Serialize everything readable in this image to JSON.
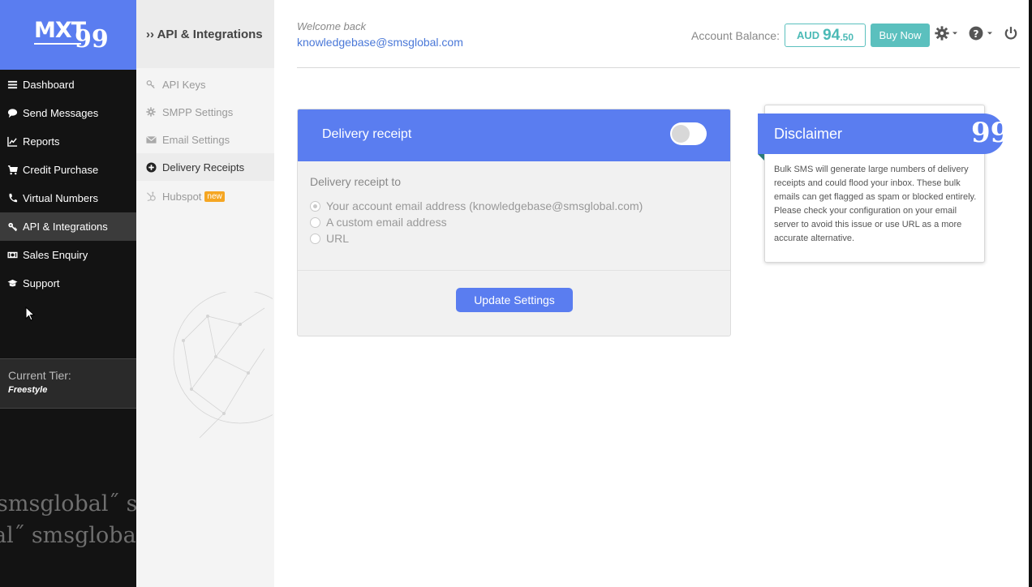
{
  "logo": {
    "text": "MXT",
    "suffix": "99"
  },
  "nav": [
    {
      "label": "Dashboard",
      "icon": "bars-icon"
    },
    {
      "label": "Send Messages",
      "icon": "chat-icon"
    },
    {
      "label": "Reports",
      "icon": "line-chart-icon"
    },
    {
      "label": "Credit Purchase",
      "icon": "cart-icon"
    },
    {
      "label": "Virtual Numbers",
      "icon": "phone-icon"
    },
    {
      "label": "API & Integrations",
      "icon": "key-icon",
      "active": true
    },
    {
      "label": "Sales Enquiry",
      "icon": "money-icon"
    },
    {
      "label": "Support",
      "icon": "graduation-cap-icon"
    }
  ],
  "tier": {
    "label": "Current Tier:",
    "value": "Freestyle"
  },
  "watermark": {
    "line1": "smsglobal˝ smsglobal˝",
    "line2": "al˝ smsglobal˝ sm"
  },
  "subnav": {
    "title": "›› API & Integrations",
    "items": [
      {
        "label": "API Keys",
        "icon": "key-icon"
      },
      {
        "label": "SMPP Settings",
        "icon": "gear-icon"
      },
      {
        "label": "Email Settings",
        "icon": "envelope-icon"
      },
      {
        "label": "Delivery Receipts",
        "icon": "plus-circle-icon",
        "active": true
      },
      {
        "label": "Hubspot",
        "icon": "hubspot-icon",
        "badge": "new"
      }
    ]
  },
  "header": {
    "welcome": "Welcome back",
    "email": "knowledgebase@smsglobal.com",
    "balance_label": "Account Balance:",
    "balance_currency": "AUD",
    "balance_int": "94",
    "balance_dec": ".50",
    "buy_label": "Buy Now"
  },
  "delivery_receipt": {
    "title": "Delivery receipt",
    "toggle_on": false,
    "to_label": "Delivery receipt to",
    "options": [
      {
        "label": "Your account email address (knowledgebase@smsglobal.com)",
        "checked": true
      },
      {
        "label": "A custom email address",
        "checked": false
      },
      {
        "label": "URL",
        "checked": false
      }
    ],
    "update_label": "Update Settings"
  },
  "disclaimer": {
    "title": "Disclaimer",
    "text": "Bulk SMS will generate large numbers of delivery receipts and could flood your inbox. These bulk emails can get flagged as spam or blocked entirely. Please check your configuration on your email server to avoid this issue or use URL as a more accurate alternative."
  },
  "colors": {
    "brand": "#5a7df0",
    "teal": "#5bc0be",
    "sidebar": "#131313",
    "badge": "#f5a623"
  }
}
